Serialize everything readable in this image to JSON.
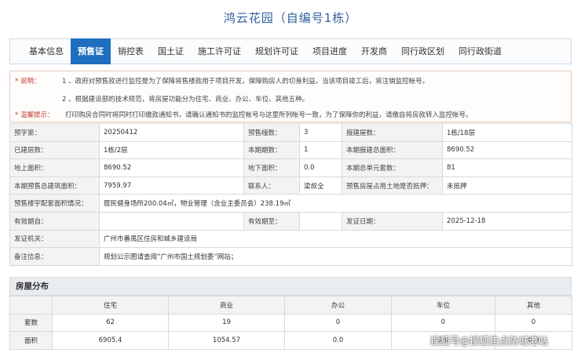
{
  "page_title": "鸿云花园（自编号1栋）",
  "tabs": [
    {
      "label": "基本信息",
      "active": false
    },
    {
      "label": "预售证",
      "active": true
    },
    {
      "label": "销控表",
      "active": false
    },
    {
      "label": "国土证",
      "active": false
    },
    {
      "label": "施工许可证",
      "active": false
    },
    {
      "label": "规划许可证",
      "active": false
    },
    {
      "label": "项目进度",
      "active": false
    },
    {
      "label": "开发商",
      "active": false
    },
    {
      "label": "同行政区划",
      "active": false
    },
    {
      "label": "同行政街道",
      "active": false
    }
  ],
  "notice": {
    "explain_label": "* 说明：",
    "item1": "1 、政府对预售款进行监控是为了保障将售楼款用于项目开发，保障购房人的切身利益。当该项目竣工后，将注销监控帐号。",
    "item2": "2 、根据建设部的技术规范，将房屋功能分为住宅、商业、办公、车位、其他五种。",
    "tip_label": "* 温馨提示：",
    "tip": "打印购房合同时将同时打印缴款通知书，请确认通知书的监控帐号与这里所列帐号一致，为了保障你的利益，请缴自将房款转入监控帐号。"
  },
  "info": {
    "presale_no_label": "预字第：",
    "presale_no": "20250412",
    "presale_floors_label": "预售幢数：",
    "presale_floors": "3",
    "report_floors_label": "报建屋数：",
    "report_floors": "1栋/18层",
    "built_floors_label": "已建层数：",
    "built_floors": "1栋/2层",
    "period_count_label": "本期期数：",
    "period_count": "1",
    "period_total_area_label": "本期报建总面积：",
    "period_total_area": "8690.52",
    "above_area_label": "地上面积：",
    "above_area": "8690.52",
    "below_area_label": "地下面积：",
    "below_area": "0.0",
    "period_units_label": "本期总单元套数：",
    "period_units": "81",
    "presale_build_area_label": "本期预售总建筑面积：",
    "presale_build_area": "7959.97",
    "contact_label": "联系人：",
    "contact": "梁叔全",
    "mortgage_label": "预售房屋占用土地是否抵押：",
    "mortgage": "未抵押",
    "facility_label": "预售楼宇配套面积情况：",
    "facility": "居民健身场所200.04㎡，物业管理（含业主委员会）238.19㎡",
    "valid_from_label": "有效期自：",
    "valid_from": "",
    "valid_to_label": "有效期至：",
    "valid_to": "",
    "issue_date_label": "发证日期：",
    "issue_date": "2025-12-18",
    "issuer_label": "发证机关：",
    "issuer": "广州市番禺区住房和城乡建设局",
    "remark_label": "备注信息：",
    "remark": "规划公示图请查阅“广州市国土规划委”网站；"
  },
  "distribution": {
    "heading": "房屋分布",
    "columns": [
      "",
      "住宅",
      "商业",
      "办公",
      "车位",
      "其他"
    ],
    "rows": [
      {
        "label": "套数",
        "values": [
          "62",
          "19",
          "0",
          "0",
          "0"
        ]
      },
      {
        "label": "面积",
        "values": [
          "6905.4",
          "1054.57",
          "0.0",
          "0.0",
          "0.0"
        ]
      }
    ]
  },
  "watermark": "搜狐号@搜狐焦点防城港站"
}
